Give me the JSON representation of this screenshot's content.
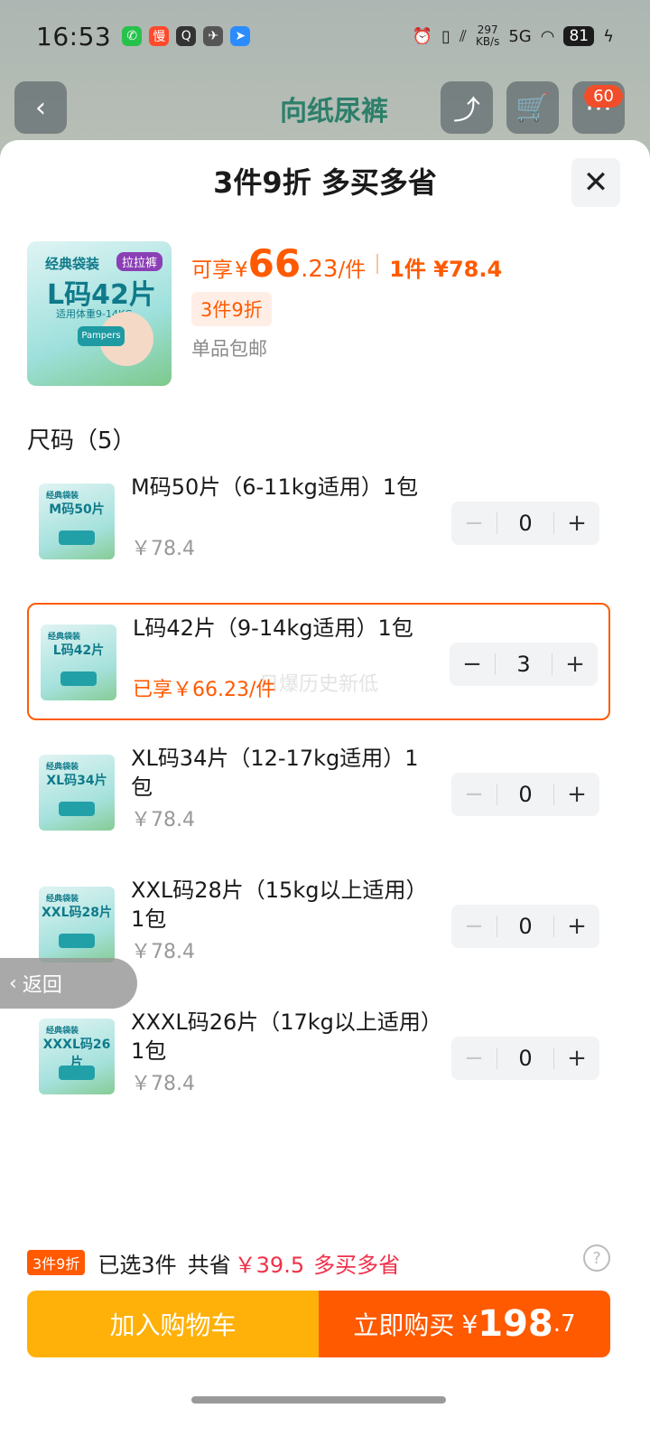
{
  "status_bar": {
    "time": "16:53",
    "net_speed_value": "297",
    "net_speed_unit": "KB/s",
    "network": "5G",
    "battery": "81"
  },
  "top_nav": {
    "banner_text": "向纸尿裤",
    "cart_badge": "60"
  },
  "sheet": {
    "title": "3件9折 多买多省",
    "close_icon": "✕"
  },
  "product": {
    "image_tag": "经典袋装",
    "image_tag2": "拉拉裤",
    "image_size": "L码42片",
    "image_sub": "适用体重9-14KG",
    "image_brand": "Pampers",
    "price_prefix": "可享",
    "price_yen": "¥",
    "price_int": "66",
    "price_dec": ".23",
    "price_unit": "/件",
    "single_price": "1件 ¥78.4",
    "promo_chip": "3件9折",
    "shipping": "单品包邮"
  },
  "section": {
    "title": "尺码（5）"
  },
  "skus": [
    {
      "thumb": "M码50片",
      "name": "M码50片（6-11kg适用）1包",
      "price": "￥78.4",
      "qty": "0"
    },
    {
      "thumb": "L码42片",
      "name": "L码42片（9-14kg适用）1包",
      "price": "已享￥66.23/件",
      "qty": "3",
      "watermark": "日爆历史新低"
    },
    {
      "thumb": "XL码34片",
      "name": "XL码34片（12-17kg适用）1包",
      "price": "￥78.4",
      "qty": "0"
    },
    {
      "thumb": "XXL码28片",
      "name": "XXL码28片（15kg以上适用）1包",
      "price": "￥78.4",
      "qty": "0"
    },
    {
      "thumb": "XXXL码26片",
      "name": "XXXL码26片（17kg以上适用）1包",
      "price": "￥78.4",
      "qty": "0"
    }
  ],
  "thumb_tag": "经典袋装",
  "stepper": {
    "minus": "−",
    "plus": "+"
  },
  "back_pill": {
    "label": "返回"
  },
  "summary": {
    "tag": "3件9折",
    "selected": "已选3件",
    "save_label": "共省",
    "save_amount": "￥39.5",
    "tagline": "多买多省",
    "help_icon": "?"
  },
  "actions": {
    "add_to_cart": "加入购物车",
    "buy_now": "立即购买",
    "buy_yen": "¥",
    "buy_int": "198",
    "buy_dec": ".7"
  },
  "colors": {
    "accent_orange": "#ff5a00",
    "cart_yellow": "#ffb109",
    "save_red": "#f0304a"
  }
}
